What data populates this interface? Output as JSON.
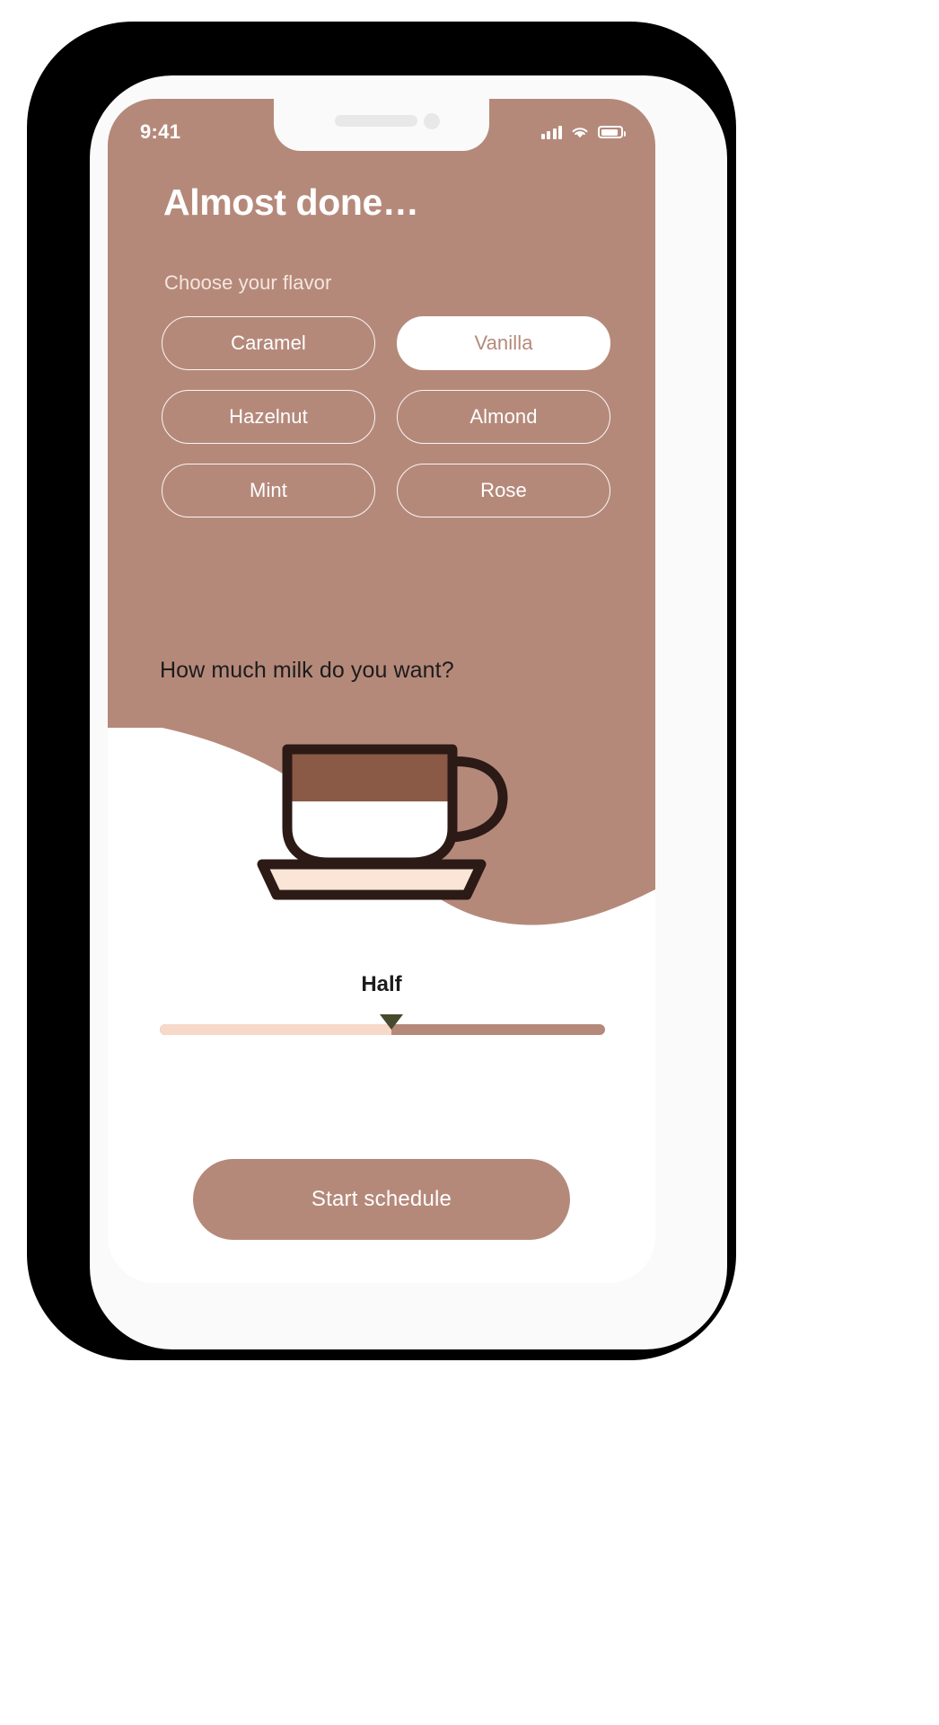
{
  "theme": {
    "brand": "#b5897a",
    "brand_dark": "#8a5a47",
    "outline_dark": "#2b1a16",
    "saucer": "#fae5d6",
    "track_left": "#f7d9c9",
    "track_right": "#b5897a",
    "thumb": "#474a2c",
    "chip_selected_bg": "#ffffff",
    "text_dark": "#1c1c1c"
  },
  "status_bar": {
    "time": "9:41",
    "signal_icon": "cellular-signal-icon",
    "wifi_icon": "wifi-icon",
    "battery_icon": "battery-icon",
    "signal_bars": 4,
    "battery_level_percent": 88
  },
  "header": {
    "title": "Almost done…",
    "subtitle": "Choose your flavor"
  },
  "flavors": {
    "selected": "Vanilla",
    "options": [
      {
        "label": "Caramel",
        "selected": false
      },
      {
        "label": "Vanilla",
        "selected": true
      },
      {
        "label": "Hazelnut",
        "selected": false
      },
      {
        "label": "Almond",
        "selected": false
      },
      {
        "label": "Mint",
        "selected": false
      },
      {
        "label": "Rose",
        "selected": false
      }
    ]
  },
  "milk": {
    "question": "How much milk do you want?",
    "illustration": "coffee-cup-icon",
    "slider_value_label": "Half",
    "slider_percent": 52,
    "slider_min_label": "",
    "slider_max_label": ""
  },
  "footer": {
    "cta_label": "Start schedule"
  }
}
